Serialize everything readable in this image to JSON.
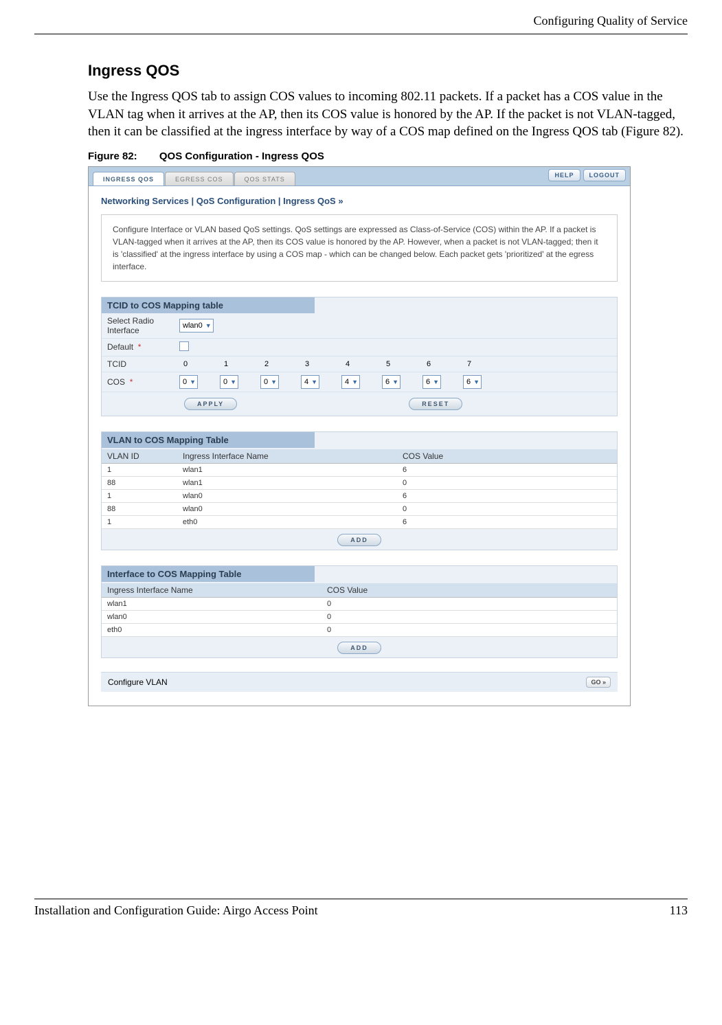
{
  "header": {
    "section_title": "Configuring Quality of Service"
  },
  "section": {
    "heading": "Ingress QOS"
  },
  "para": "Use the Ingress QOS tab to assign COS values to incoming 802.11 packets. If a packet has a COS value in the VLAN tag when it arrives at the AP, then its COS value is honored by the AP. If the packet is not VLAN-tagged, then it can be classified at the ingress interface by way of a COS map defined on the Ingress QOS tab (Figure 82).",
  "figure": {
    "num": "Figure 82:",
    "title": "QOS Configuration - Ingress QOS"
  },
  "shot": {
    "tabs": {
      "ingress": "INGRESS QOS",
      "egress": "EGRESS COS",
      "stats": "QOS STATS"
    },
    "topbtn": {
      "help": "HELP",
      "logout": "LOGOUT"
    },
    "breadcrumb": "Networking Services | QoS Configuration | Ingress QoS  »",
    "desc": "Configure Interface or VLAN based QoS settings. QoS settings are expressed as Class-of-Service (COS) within the AP. If a packet is VLAN-tagged when it arrives at the AP, then its COS value is honored by the AP. However, when a packet is not VLAN-tagged; then it is 'classified' at the ingress interface by using a COS map - which can be changed below. Each packet gets 'prioritized' at the egress interface.",
    "tcid": {
      "head": "TCID to COS Mapping table",
      "select_label": "Select Radio Interface",
      "select_value": "wlan0",
      "default_label": "Default",
      "tcid_label": "TCID",
      "cos_label": "COS",
      "tcid_vals": [
        "0",
        "1",
        "2",
        "3",
        "4",
        "5",
        "6",
        "7"
      ],
      "cos_vals": [
        "0",
        "0",
        "0",
        "4",
        "4",
        "6",
        "6",
        "6"
      ],
      "apply": "APPLY",
      "reset": "RESET"
    },
    "vlan": {
      "head": "VLAN to COS Mapping Table",
      "h1": "VLAN ID",
      "h2": "Ingress Interface Name",
      "h3": "COS Value",
      "rows": [
        {
          "id": "1",
          "if": "wlan1",
          "cos": "6"
        },
        {
          "id": "88",
          "if": "wlan1",
          "cos": "0"
        },
        {
          "id": "1",
          "if": "wlan0",
          "cos": "6"
        },
        {
          "id": "88",
          "if": "wlan0",
          "cos": "0"
        },
        {
          "id": "1",
          "if": "eth0",
          "cos": "6"
        }
      ],
      "add": "ADD"
    },
    "iface": {
      "head": "Interface to COS Mapping Table",
      "h1": "Ingress Interface Name",
      "h2": "COS Value",
      "rows": [
        {
          "if": "wlan1",
          "cos": "0"
        },
        {
          "if": "wlan0",
          "cos": "0"
        },
        {
          "if": "eth0",
          "cos": "0"
        }
      ],
      "add": "ADD"
    },
    "golabel": "Configure VLAN",
    "gobtn": "GO »"
  },
  "footer": {
    "left": "Installation and Configuration Guide: Airgo Access Point",
    "right": "113"
  }
}
